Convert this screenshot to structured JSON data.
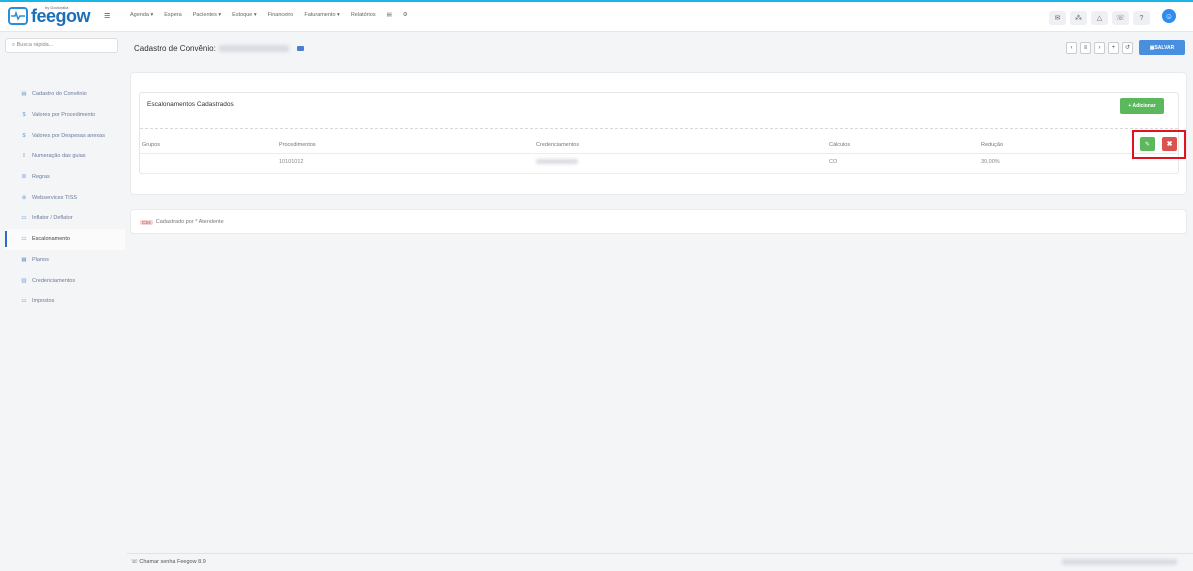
{
  "topbar": {
    "logo": "feegow",
    "logo_sub": "by Doctoralia",
    "menu_icon": "hamburger-icon",
    "nav": [
      {
        "label": "Agenda",
        "caret": "▾"
      },
      {
        "label": "Espera",
        "caret": ""
      },
      {
        "label": "Pacientes",
        "caret": "▾"
      },
      {
        "label": "Estoque",
        "caret": "▾"
      },
      {
        "label": "Financeiro",
        "caret": ""
      },
      {
        "label": "Faturamento",
        "caret": "▾"
      },
      {
        "label": "Relatórios",
        "caret": ""
      }
    ],
    "nav_icons": [
      "▤",
      "⚙"
    ],
    "right_icons": [
      {
        "name": "mail-icon",
        "glyph": "✉"
      },
      {
        "name": "grid-icon",
        "glyph": "⁂"
      },
      {
        "name": "bell-icon",
        "glyph": "△"
      },
      {
        "name": "chat-icon",
        "glyph": "☏"
      },
      {
        "name": "help-icon",
        "glyph": "?"
      }
    ],
    "user_glyph": "☺"
  },
  "search": {
    "placeholder": "Busca rápida...",
    "icon": "⌕"
  },
  "sidebar": {
    "items": [
      {
        "label": "Cadastro do Convênio",
        "icon": "▤",
        "icon_name": "card-icon",
        "active": false
      },
      {
        "label": "Valores por Procedimento",
        "icon": "$",
        "icon_name": "dollar-icon",
        "active": false
      },
      {
        "label": "Valores por Despesas anexas",
        "icon": "$",
        "icon_name": "dollar-icon",
        "active": false
      },
      {
        "label": "Numeração das guias",
        "icon": "⁞⁞",
        "icon_name": "numbering-icon",
        "active": false
      },
      {
        "label": "Regras",
        "icon": "⚙",
        "icon_name": "rules-icon",
        "active": false
      },
      {
        "label": "Webservices TISS",
        "icon": "⊛",
        "icon_name": "webservice-icon",
        "active": false
      },
      {
        "label": "Inflator / Deflator",
        "icon": "▭",
        "icon_name": "inflator-icon",
        "active": false
      },
      {
        "label": "Escalonamento",
        "icon": "▭",
        "icon_name": "scaling-icon",
        "active": true
      },
      {
        "label": "Planos",
        "icon": "▦",
        "icon_name": "plans-icon",
        "active": false
      },
      {
        "label": "Credenciamentos",
        "icon": "▥",
        "icon_name": "credential-icon",
        "active": false
      },
      {
        "label": "Impostos",
        "icon": "▭",
        "icon_name": "tax-icon",
        "active": false
      }
    ]
  },
  "page": {
    "title": "Cadastro de Convênio:"
  },
  "toolbar": {
    "buttons": [
      {
        "name": "prev-button",
        "glyph": "‹"
      },
      {
        "name": "list-button",
        "glyph": "≡"
      },
      {
        "name": "next-button",
        "glyph": "›"
      },
      {
        "name": "add-button",
        "glyph": "+"
      },
      {
        "name": "history-button",
        "glyph": "↺"
      }
    ],
    "save_label": "SALVAR",
    "save_icon": "▣"
  },
  "panel": {
    "title": "Escalonamentos Cadastrados",
    "add_label": "+ Adicionar",
    "headers": {
      "grupos": "Grupos",
      "procedimentos": "Procedimentos",
      "credenciamentos": "Credenciamentos",
      "calculos": "Cálculos",
      "reducao": "Redução"
    },
    "row": {
      "grupos": "",
      "procedimentos": "10101012",
      "calculos": "CO",
      "reducao": "30,00%"
    },
    "edit_glyph": "✎",
    "delete_glyph": "✖"
  },
  "audit": {
    "badge": "CS4",
    "text": "Cadastrado por * Atendente"
  },
  "footer": {
    "text": "☏ Chamar senha Feegow 8.9"
  },
  "colors": {
    "accent": "#19b5e6",
    "primary": "#4a8fdf",
    "success": "#5cb85c",
    "danger": "#d9534f",
    "highlight": "#e0141e"
  }
}
